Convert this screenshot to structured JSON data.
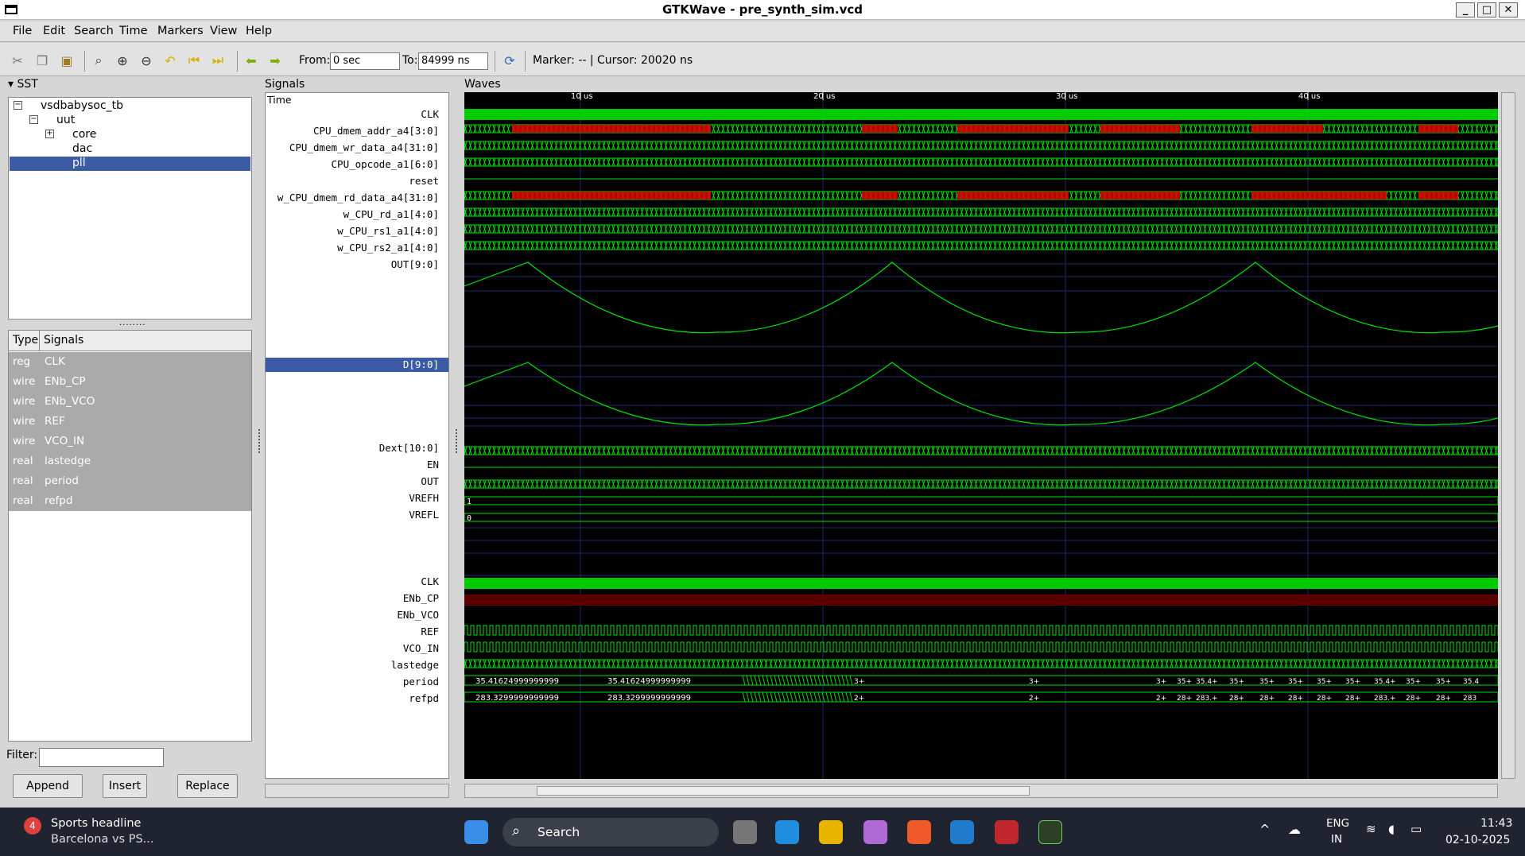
{
  "window": {
    "title": "GTKWave - pre_synth_sim.vcd"
  },
  "menu": [
    "File",
    "Edit",
    "Search",
    "Time",
    "Markers",
    "View",
    "Help"
  ],
  "toolbar": {
    "from_label": "From:",
    "from_value": "0 sec",
    "to_label": "To:",
    "to_value": "84999 ns",
    "status": "Marker: --  |  Cursor: 20020 ns"
  },
  "sst": {
    "header": "SST",
    "tree": [
      "vsdbabysoc_tb",
      "uut",
      "core",
      "dac",
      "pll"
    ],
    "selected": "pll"
  },
  "typelist": {
    "headers": [
      "Type",
      "Signals"
    ],
    "rows": [
      {
        "type": "reg",
        "name": "CLK"
      },
      {
        "type": "wire",
        "name": "ENb_CP"
      },
      {
        "type": "wire",
        "name": "ENb_VCO"
      },
      {
        "type": "wire",
        "name": "REF"
      },
      {
        "type": "wire",
        "name": "VCO_IN"
      },
      {
        "type": "real",
        "name": "lastedge"
      },
      {
        "type": "real",
        "name": "period"
      },
      {
        "type": "real",
        "name": "refpd"
      }
    ]
  },
  "filter_label": "Filter:",
  "buttons": {
    "append": "Append",
    "insert": "Insert",
    "replace": "Replace"
  },
  "signals_header": "Signals",
  "waves_header": "Waves",
  "signals": [
    "Time",
    "CLK",
    "CPU_dmem_addr_a4[3:0]",
    "CPU_dmem_wr_data_a4[31:0]",
    "CPU_opcode_a1[6:0]",
    "reset",
    "w_CPU_dmem_rd_data_a4[31:0]",
    "w_CPU_rd_a1[4:0]",
    "w_CPU_rs1_a1[4:0]",
    "w_CPU_rs2_a1[4:0]",
    "OUT[9:0]",
    "D[9:0]",
    "Dext[10:0]",
    "EN",
    "OUT",
    "VREFH",
    "VREFL",
    "CLK",
    "ENb_CP",
    "ENb_VCO",
    "REF",
    "VCO_IN",
    "lastedge",
    "period",
    "refpd"
  ],
  "selected_signal": "D[9:0]",
  "timeline": [
    "10 us",
    "20 us",
    "30 us",
    "40 us"
  ],
  "wave_values": {
    "vrefh": "1",
    "vrefl": "0",
    "period_a": "35.41624999999999",
    "period_b": "35.41624999999999",
    "refpd_a": "283.3299999999999",
    "refpd_b": "283.3299999999999",
    "period_tail": [
      "3+",
      "3+",
      "3+",
      "35+",
      "35.4+",
      "35+",
      "35+",
      "35+",
      "35+",
      "35+",
      "35.4+",
      "35+",
      "35+",
      "35.4"
    ],
    "refpd_tail": [
      "2+",
      "2+",
      "2+",
      "28+",
      "283.+",
      "28+",
      "28+",
      "28+",
      "28+",
      "28+",
      "283.+",
      "28+",
      "28+",
      "283"
    ]
  },
  "taskbar": {
    "news_title": "Sports headline",
    "news_sub": "Barcelona vs PS...",
    "news_badge": "4",
    "search": "Search",
    "lang1": "ENG",
    "lang2": "IN",
    "time": "11:43",
    "date": "02-10-2025"
  },
  "colors": {
    "wave": "#00e000",
    "wave_alt": "#e00000",
    "selected": "#3b5ba5"
  }
}
